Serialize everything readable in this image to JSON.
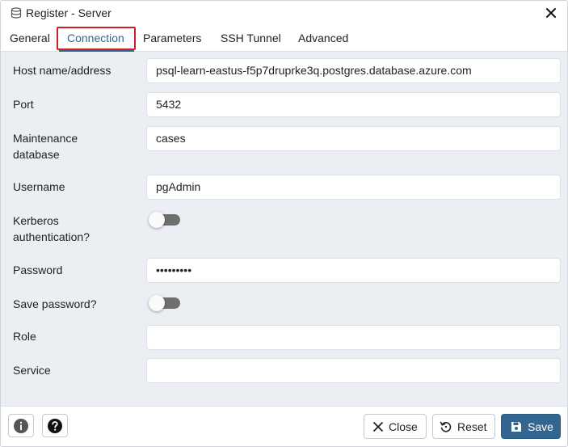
{
  "window": {
    "title": "Register - Server",
    "title_icon": "database-icon",
    "close_icon": "close-icon"
  },
  "tabs": [
    {
      "label": "General"
    },
    {
      "label": "Connection",
      "active": true
    },
    {
      "label": "Parameters"
    },
    {
      "label": "SSH Tunnel"
    },
    {
      "label": "Advanced"
    }
  ],
  "form": {
    "host": {
      "label": "Host name/address",
      "value": "psql-learn-eastus-f5p7druprke3q.postgres.database.azure.com"
    },
    "port": {
      "label": "Port",
      "value": "5432"
    },
    "maintenance_db": {
      "label_line1": "Maintenance",
      "label_line2": "database",
      "value": "cases"
    },
    "username": {
      "label": "Username",
      "value": "pgAdmin"
    },
    "kerberos": {
      "label_line1": "Kerberos",
      "label_line2": "authentication?",
      "enabled": false
    },
    "password": {
      "label": "Password",
      "value": "•••••••••"
    },
    "save_password": {
      "label": "Save password?",
      "enabled": false
    },
    "role": {
      "label": "Role",
      "value": ""
    },
    "service": {
      "label": "Service",
      "value": ""
    }
  },
  "footer": {
    "info_icon": "info-icon",
    "help_icon": "help-icon",
    "close_label": "Close",
    "reset_label": "Reset",
    "save_label": "Save"
  },
  "colors": {
    "accent": "#326690",
    "highlight": "#d21f24",
    "content_bg": "#ebeef3"
  }
}
